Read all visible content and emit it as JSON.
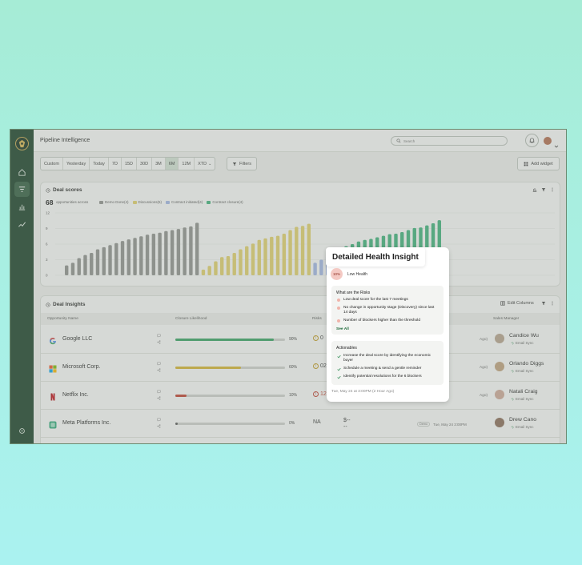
{
  "app": {
    "page_title": "Pipeline Intelligence",
    "search_placeholder": "Search"
  },
  "sidebar": {
    "items": [
      "home-icon",
      "filter-icon",
      "chart-icon",
      "trend-icon"
    ],
    "bottom": "settings-icon"
  },
  "controls": {
    "ranges": [
      "Custom",
      "Yesterday",
      "Today",
      "7D",
      "15D",
      "30D",
      "3M",
      "6M",
      "12M",
      "XTD"
    ],
    "active_range": "6M",
    "filters_label": "Filters",
    "add_widget_label": "Add widget"
  },
  "deal_scores": {
    "title": "Deal scores",
    "count": "68",
    "count_label": "opportunities across",
    "legend": [
      {
        "name": "Demo Done(4)",
        "color": "#8f908e"
      },
      {
        "name": "Discussions(5)",
        "color": "#e6d46a"
      },
      {
        "name": "Contract initiated(4)",
        "color": "#a3b7ea"
      },
      {
        "name": "Contract closure(4)",
        "color": "#3bb37a"
      }
    ]
  },
  "chart_data": {
    "type": "bar",
    "yticks": [
      "12",
      "9",
      "6",
      "3",
      "0"
    ],
    "ylim": [
      0,
      12
    ],
    "series": [
      {
        "color": "#8f908e",
        "values": [
          1.9,
          2.4,
          3.3,
          3.9,
          4.3,
          5.0,
          5.4,
          5.8,
          6.2,
          6.6,
          6.9,
          7.2,
          7.5,
          7.8,
          8.0,
          8.2,
          8.5,
          8.7,
          8.9,
          9.2,
          9.4,
          10.1
        ]
      },
      {
        "color": "#e6d46a",
        "values": [
          1.1,
          1.8,
          2.7,
          3.5,
          3.7,
          4.3,
          5.0,
          5.6,
          6.1,
          6.8,
          7.1,
          7.4,
          7.6,
          8.0,
          8.7,
          9.3,
          9.5,
          9.9
        ]
      },
      {
        "color": "#a3b7ea",
        "values": [
          2.4,
          3.0,
          3.7,
          4.5,
          5.2
        ]
      },
      {
        "color": "#3bb37a",
        "values": [
          5.6,
          6.0,
          6.5,
          6.8,
          7.0,
          7.3,
          7.6,
          7.9,
          8.0,
          8.3,
          8.7,
          9.1,
          9.2,
          9.6,
          10.0,
          10.6
        ]
      }
    ]
  },
  "deal_insights": {
    "title": "Deal Insights",
    "edit_columns": "Edit Columns",
    "columns": [
      "Opportunity Name",
      "Closure Likelihood",
      "Risks",
      "Sales Manager"
    ],
    "rows": [
      {
        "name": "Google LLC",
        "icon": "google-logo",
        "likelihood": 0.9,
        "pct": "90%",
        "bar_color": "#2fa25e",
        "risk": "0",
        "risk_type": "warn",
        "money": "",
        "money2": "",
        "sync_extra": "",
        "sync_time": "",
        "manager": "Candice Wu",
        "manager_sub": "Email Sync",
        "avatar_color": "#b9a38e"
      },
      {
        "name": "Microsoft Corp.",
        "icon": "microsoft-logo",
        "likelihood": 0.6,
        "pct": "60%",
        "bar_color": "#d8b42a",
        "risk": "02",
        "risk_type": "warn",
        "money": "",
        "money2": "",
        "sync_extra": "",
        "sync_time": "",
        "manager": "Orlando Diggs",
        "manager_sub": "Email Sync",
        "avatar_color": "#c2a27c"
      },
      {
        "name": "Netflix Inc.",
        "icon": "netflix-logo",
        "likelihood": 0.1,
        "pct": "10%",
        "bar_color": "#c23a2a",
        "risk": "12",
        "risk_type": "red",
        "money": "",
        "money2": "",
        "sync_extra": "",
        "sync_time": "",
        "manager": "Natali Craig",
        "manager_sub": "Email Sync",
        "avatar_color": "#d2a998"
      },
      {
        "name": "Meta Platforms Inc.",
        "icon": "meta-logo",
        "likelihood": 0.0,
        "pct": "0%",
        "bar_color": "#555555",
        "risk": "NA",
        "risk_type": "none",
        "money": "$--",
        "money2": "--",
        "sync_extra": "Demo",
        "sync_time": "Tue, May 24 3:00PM",
        "manager": "Drew Cano",
        "manager_sub": "Email Sync",
        "avatar_color": "#8a6a55"
      }
    ],
    "side_times": [
      "Ago)",
      "Ago)",
      "Ago)"
    ]
  },
  "popover": {
    "title": "Detailed Health Insight",
    "health_pct": "10%",
    "health_label": "Low Health",
    "risks_heading": "What are the Risks",
    "risks": [
      "Low deal score for the last 7 meetings",
      "No change in opportunity stage (Discovery) since last 14 days",
      "Number of blockers higher than the threshold"
    ],
    "see_all": "See All",
    "actionables_heading": "Actionables",
    "actionables": [
      "Increase the deal score by identifying the economic buyer",
      "Schedule a meeting & send a gentle reminder",
      "Identify potential resolutions for the 6 blockers"
    ],
    "timestamp": "Tue, May 24 at 3:00PM (2 Hour Ago)"
  }
}
